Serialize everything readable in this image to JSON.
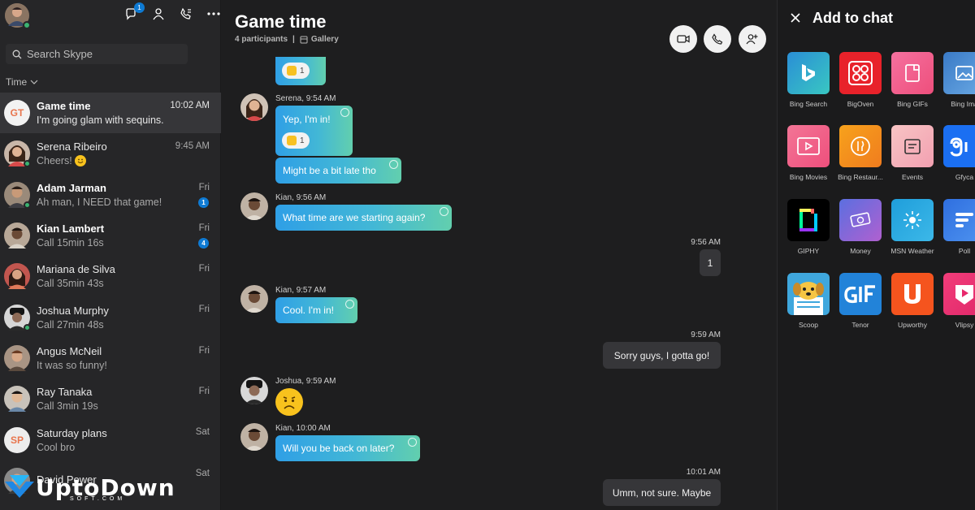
{
  "sidebar": {
    "notifications_count": "1",
    "search_placeholder": "Search Skype",
    "sort_label": "Time",
    "chats": [
      {
        "name": "Game time",
        "preview": "I'm going glam with sequins.",
        "time": "10:02 AM",
        "initials": "GT",
        "bold": true,
        "active": true
      },
      {
        "name": "Serena Ribeiro",
        "preview": "Cheers!",
        "time": "9:45 AM",
        "online": true,
        "emoji": "smiley"
      },
      {
        "name": "Adam Jarman",
        "preview": "Ah man, I NEED that game!",
        "time": "Fri",
        "bold": true,
        "unread": "1",
        "online": true
      },
      {
        "name": "Kian Lambert",
        "preview": "Call 15min 16s",
        "time": "Fri",
        "bold": true,
        "unread": "4"
      },
      {
        "name": "Mariana de Silva",
        "preview": "Call 35min 43s",
        "time": "Fri"
      },
      {
        "name": "Joshua Murphy",
        "preview": "Call 27min 48s",
        "time": "Fri",
        "online": true
      },
      {
        "name": "Angus McNeil",
        "preview": "It was so funny!",
        "time": "Fri"
      },
      {
        "name": "Ray Tanaka",
        "preview": "Call 3min 19s",
        "time": "Fri"
      },
      {
        "name": "Saturday plans",
        "preview": "Cool bro",
        "time": "Sat",
        "initials": "SP"
      },
      {
        "name": "David Power",
        "preview": "",
        "time": "Sat"
      }
    ]
  },
  "watermark": {
    "text": "UptoDown",
    "sub": "SOFT.COM"
  },
  "conversation": {
    "title": "Game time",
    "participants": "4 participants",
    "separator": "|",
    "gallery": "Gallery",
    "messages": {
      "top_thumb_count": "1",
      "m1_sender": "Serena, 9:54 AM",
      "m1_text": "Yep, I'm in!",
      "m1_thumb_count": "1",
      "m2_text": "Might be a bit late tho",
      "m3_sender": "Kian, 9:56 AM",
      "m3_text": "What time are we starting again?",
      "m4_time": "9:56 AM",
      "m4_text": "1",
      "m5_sender": "Kian, 9:57 AM",
      "m5_text": "Cool. I'm in!",
      "m6_time": "9:59 AM",
      "m6_text": "Sorry guys, I gotta go!",
      "m7_sender": "Joshua, 9:59 AM",
      "m8_sender": "Kian, 10:00 AM",
      "m8_text": "Will you be back on later?",
      "m9_time": "10:01 AM",
      "m9_text": "Umm, not sure. Maybe"
    }
  },
  "panel": {
    "title": "Add to chat",
    "apps": [
      {
        "label": "Bing Search",
        "color": "#1a9fd9"
      },
      {
        "label": "BigOven",
        "color": "#e8222a"
      },
      {
        "label": "Bing GIFs",
        "color": "#f25a8c"
      },
      {
        "label": "Bing Ima",
        "color": "#4b86c9"
      },
      {
        "label": "Bing Movies",
        "color": "#f05a88"
      },
      {
        "label": "Bing Restaur...",
        "color": "#f7931d"
      },
      {
        "label": "Events",
        "color": "#f3a3ae"
      },
      {
        "label": "Gfyca",
        "color": "#1b6ff2"
      },
      {
        "label": "GIPHY",
        "color": "#000000"
      },
      {
        "label": "Money",
        "color": "#7a55c9"
      },
      {
        "label": "MSN Weather",
        "color": "#2aa8e0"
      },
      {
        "label": "Poll",
        "color": "#2f6fe0"
      },
      {
        "label": "Scoop",
        "color": "#3fa7dd"
      },
      {
        "label": "Tenor",
        "color": "#2283d9"
      },
      {
        "label": "Upworthy",
        "color": "#f5541e"
      },
      {
        "label": "Vlipsy",
        "color": "#ed2a6f"
      }
    ]
  }
}
